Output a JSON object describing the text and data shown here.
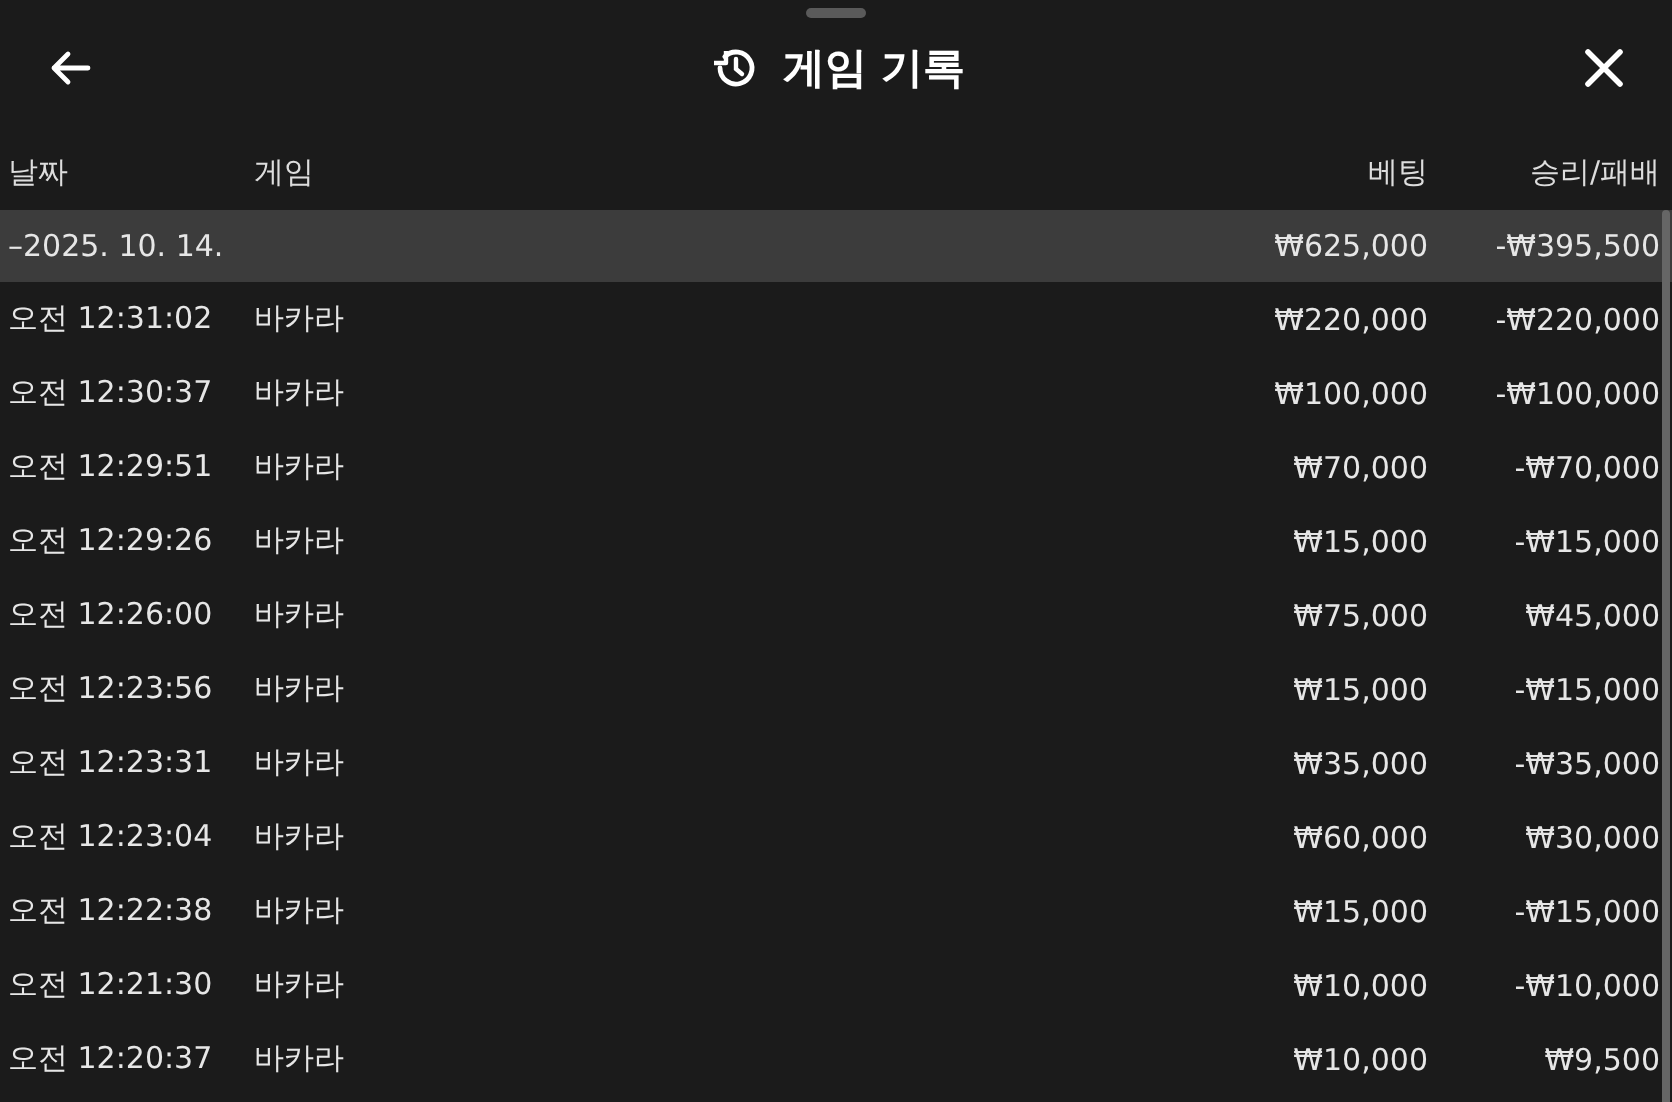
{
  "header": {
    "title": "게임 기록"
  },
  "table": {
    "columns": [
      "날짜",
      "게임",
      "베팅",
      "승리/패배"
    ],
    "group": {
      "date": "–2025. 10. 14.",
      "bet": "₩625,000",
      "result": "-₩395,500"
    },
    "rows": [
      {
        "time": "오전 12:31:02",
        "game": "바카라",
        "bet": "₩220,000",
        "result": "-₩220,000"
      },
      {
        "time": "오전 12:30:37",
        "game": "바카라",
        "bet": "₩100,000",
        "result": "-₩100,000"
      },
      {
        "time": "오전 12:29:51",
        "game": "바카라",
        "bet": "₩70,000",
        "result": "-₩70,000"
      },
      {
        "time": "오전 12:29:26",
        "game": "바카라",
        "bet": "₩15,000",
        "result": "-₩15,000"
      },
      {
        "time": "오전 12:26:00",
        "game": "바카라",
        "bet": "₩75,000",
        "result": "₩45,000"
      },
      {
        "time": "오전 12:23:56",
        "game": "바카라",
        "bet": "₩15,000",
        "result": "-₩15,000"
      },
      {
        "time": "오전 12:23:31",
        "game": "바카라",
        "bet": "₩35,000",
        "result": "-₩35,000"
      },
      {
        "time": "오전 12:23:04",
        "game": "바카라",
        "bet": "₩60,000",
        "result": "₩30,000"
      },
      {
        "time": "오전 12:22:38",
        "game": "바카라",
        "bet": "₩15,000",
        "result": "-₩15,000"
      },
      {
        "time": "오전 12:21:30",
        "game": "바카라",
        "bet": "₩10,000",
        "result": "-₩10,000"
      },
      {
        "time": "오전 12:20:37",
        "game": "바카라",
        "bet": "₩10,000",
        "result": "₩9,500"
      }
    ]
  }
}
